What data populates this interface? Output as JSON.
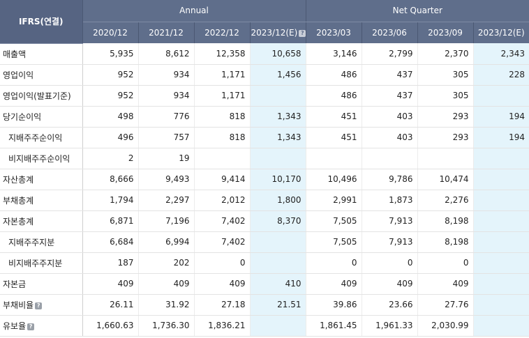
{
  "header": {
    "corner": "IFRS(연결)",
    "annual_label": "Annual",
    "quarter_label": "Net Quarter",
    "periods": [
      "2020/12",
      "2021/12",
      "2022/12",
      "2023/12(E)",
      "2023/03",
      "2023/06",
      "2023/09",
      "2023/12(E)"
    ],
    "help_glyph": "?"
  },
  "rows": [
    {
      "label": "매출액",
      "values": [
        "5,935",
        "8,612",
        "12,358",
        "10,658",
        "3,146",
        "2,799",
        "2,370",
        "2,343"
      ]
    },
    {
      "label": "영업이익",
      "values": [
        "952",
        "934",
        "1,171",
        "1,456",
        "486",
        "437",
        "305",
        "228"
      ]
    },
    {
      "label": "영업이익(발표기준)",
      "values": [
        "952",
        "934",
        "1,171",
        "",
        "486",
        "437",
        "305",
        ""
      ]
    },
    {
      "label": "당기순이익",
      "values": [
        "498",
        "776",
        "818",
        "1,343",
        "451",
        "403",
        "293",
        "194"
      ]
    },
    {
      "label": "지배주주순이익",
      "values": [
        "496",
        "757",
        "818",
        "1,343",
        "451",
        "403",
        "293",
        "194"
      ]
    },
    {
      "label": "비지배주주순이익",
      "values": [
        "2",
        "19",
        "",
        "",
        "",
        "",
        "",
        ""
      ]
    },
    {
      "label": "자산총계",
      "values": [
        "8,666",
        "9,493",
        "9,414",
        "10,170",
        "10,496",
        "9,786",
        "10,474",
        ""
      ]
    },
    {
      "label": "부채총계",
      "values": [
        "1,794",
        "2,297",
        "2,012",
        "1,800",
        "2,991",
        "1,873",
        "2,276",
        ""
      ]
    },
    {
      "label": "자본총계",
      "values": [
        "6,871",
        "7,196",
        "7,402",
        "8,370",
        "7,505",
        "7,913",
        "8,198",
        ""
      ]
    },
    {
      "label": "지배주주지분",
      "values": [
        "6,684",
        "6,994",
        "7,402",
        "",
        "7,505",
        "7,913",
        "8,198",
        ""
      ]
    },
    {
      "label": "비지배주주지분",
      "values": [
        "187",
        "202",
        "0",
        "",
        "0",
        "0",
        "0",
        ""
      ]
    },
    {
      "label": "자본금",
      "values": [
        "409",
        "409",
        "409",
        "410",
        "409",
        "409",
        "409",
        ""
      ]
    },
    {
      "label": "부채비율",
      "values": [
        "26.11",
        "31.92",
        "27.18",
        "21.51",
        "39.86",
        "23.66",
        "27.76",
        ""
      ]
    },
    {
      "label": "유보율",
      "values": [
        "1,660.63",
        "1,736.30",
        "1,836.21",
        "",
        "1,861.45",
        "1,961.33",
        "2,030.99",
        ""
      ]
    }
  ]
}
